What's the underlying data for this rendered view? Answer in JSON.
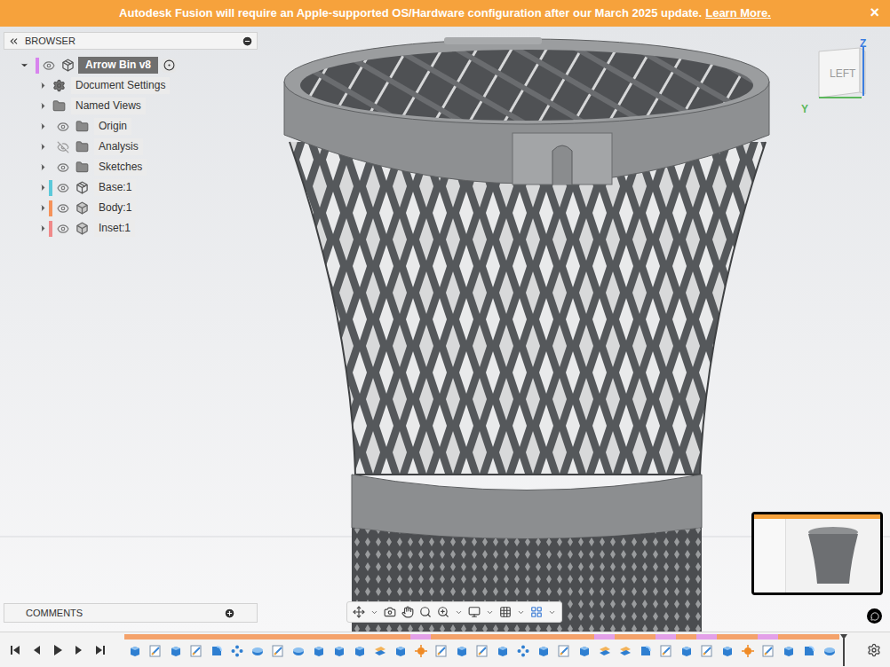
{
  "banner": {
    "message": "Autodesk Fusion will require an Apple-supported OS/Hardware configuration after our March 2025 update.",
    "link": "Learn More.",
    "close": "×"
  },
  "browser": {
    "title": "BROWSER",
    "root": {
      "name": "Arrow Bin v8",
      "expanded": true,
      "visible": true,
      "active": true,
      "color": "#d884ee"
    },
    "items": [
      {
        "name": "Document Settings",
        "kind": "settings",
        "expanded": false
      },
      {
        "name": "Named Views",
        "kind": "views",
        "expanded": false
      },
      {
        "name": "Origin",
        "kind": "folder",
        "expanded": false,
        "visible": true
      },
      {
        "name": "Analysis",
        "kind": "folder",
        "expanded": false,
        "visible": false
      },
      {
        "name": "Sketches",
        "kind": "folder",
        "expanded": false,
        "visible": true
      },
      {
        "name": "Base:1",
        "kind": "component",
        "expanded": false,
        "visible": true,
        "color": "#5cc9da"
      },
      {
        "name": "Body:1",
        "kind": "body",
        "expanded": false,
        "visible": true,
        "color": "#f5925a"
      },
      {
        "name": "Inset:1",
        "kind": "body",
        "expanded": false,
        "visible": true,
        "color": "#f08a8a"
      }
    ]
  },
  "comments": {
    "title": "COMMENTS"
  },
  "viewcube": {
    "face": "LEFT",
    "axes": [
      {
        "label": "Z",
        "color": "#3b7de0"
      },
      {
        "label": "Y",
        "color": "#5cb85c"
      }
    ]
  },
  "timeline": {
    "features": [
      {
        "kind": "extrude",
        "color": "#f4a26b"
      },
      {
        "kind": "sketch",
        "color": "#f4a26b"
      },
      {
        "kind": "extrude",
        "color": "#f4a26b"
      },
      {
        "kind": "sketch",
        "color": "#f4a26b"
      },
      {
        "kind": "fillet",
        "color": "#f4a26b"
      },
      {
        "kind": "pattern",
        "color": "#f4a26b"
      },
      {
        "kind": "revolve",
        "color": "#f4a26b"
      },
      {
        "kind": "sketch",
        "color": "#f4a26b"
      },
      {
        "kind": "revolve",
        "color": "#f4a26b"
      },
      {
        "kind": "extrude",
        "color": "#f4a26b"
      },
      {
        "kind": "extrude",
        "color": "#f4a26b"
      },
      {
        "kind": "extrude",
        "color": "#f4a26b"
      },
      {
        "kind": "plane",
        "color": "#f4a26b"
      },
      {
        "kind": "extrude",
        "color": "#f4a26b"
      },
      {
        "kind": "move",
        "color": "#e3a0e8"
      },
      {
        "kind": "sketch",
        "color": "#f4a26b"
      },
      {
        "kind": "extrude",
        "color": "#f4a26b"
      },
      {
        "kind": "sketch",
        "color": "#f4a26b"
      },
      {
        "kind": "extrude",
        "color": "#f4a26b"
      },
      {
        "kind": "pattern",
        "color": "#f4a26b"
      },
      {
        "kind": "extrude",
        "color": "#f4a26b"
      },
      {
        "kind": "sketch",
        "color": "#f4a26b"
      },
      {
        "kind": "extrude",
        "color": "#f4a26b"
      },
      {
        "kind": "plane",
        "color": "#e3a0e8"
      },
      {
        "kind": "plane",
        "color": "#f4a26b"
      },
      {
        "kind": "fillet",
        "color": "#f4a26b"
      },
      {
        "kind": "sketch",
        "color": "#e3a0e8"
      },
      {
        "kind": "extrude",
        "color": "#f4a26b"
      },
      {
        "kind": "sketch",
        "color": "#e3a0e8"
      },
      {
        "kind": "extrude",
        "color": "#f4a26b"
      },
      {
        "kind": "move",
        "color": "#f4a26b"
      },
      {
        "kind": "sketch",
        "color": "#e3a0e8"
      },
      {
        "kind": "extrude",
        "color": "#f4a26b"
      },
      {
        "kind": "fillet",
        "color": "#f4a26b"
      },
      {
        "kind": "revolve",
        "color": "#f4a26b"
      }
    ]
  }
}
